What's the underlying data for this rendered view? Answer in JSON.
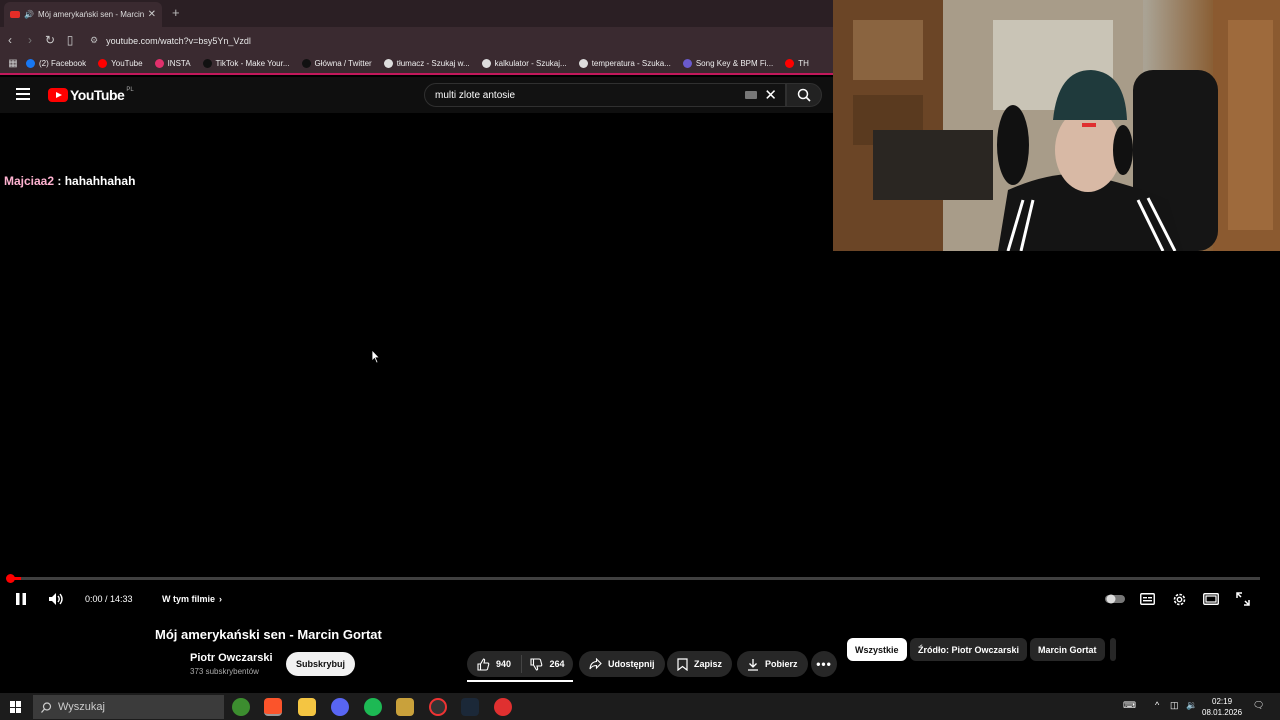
{
  "browser": {
    "tab_title": "Mój amerykański sen - Marcin",
    "address": "youtube.com/watch?v=bsy5Yn_Vzdl",
    "bookmarks": [
      {
        "label": "(2) Facebook",
        "color": "#1877f2"
      },
      {
        "label": "YouTube",
        "color": "#ff0000"
      },
      {
        "label": "INSTA",
        "color": "#e1306c"
      },
      {
        "label": "TikTok - Make Your...",
        "color": "#111111"
      },
      {
        "label": "Główna / Twitter",
        "color": "#111111"
      },
      {
        "label": "tłumacz - Szukaj w...",
        "color": "#dddddd"
      },
      {
        "label": "kalkulator - Szukaj...",
        "color": "#dddddd"
      },
      {
        "label": "temperatura - Szuka...",
        "color": "#dddddd"
      },
      {
        "label": "Song Key & BPM Fi...",
        "color": "#6a5acd"
      },
      {
        "label": "TH",
        "color": "#ff0000"
      }
    ]
  },
  "youtube": {
    "logo_text": "YouTube",
    "country_code": "PL",
    "search_value": "multi zlote antosie"
  },
  "chat": {
    "user": "Majciaa2",
    "separator": " : ",
    "message": "hahahhahah"
  },
  "player": {
    "time": "0:00 / 14:33",
    "progress_fraction": 0.01,
    "chapter_label": "W tym filmie"
  },
  "video": {
    "title": "Mój amerykański sen - Marcin Gortat",
    "channel": "Piotr Owczarski",
    "subscribers": "373 subskrybentów",
    "subscribe_label": "Subskrybuj",
    "likes": "940",
    "dislikes": "264",
    "share_label": "Udostępnij",
    "save_label": "Zapisz",
    "download_label": "Pobierz"
  },
  "chips": [
    "Wszystkie",
    "Źródło: Piotr Owczarski",
    "Marcin Gortat"
  ],
  "taskbar": {
    "search_placeholder": "Wyszukaj",
    "time": "02:19",
    "date": "08.01.2026"
  },
  "colors": {
    "accent": "#ff0000",
    "chat_user": "#ffb3d1"
  }
}
